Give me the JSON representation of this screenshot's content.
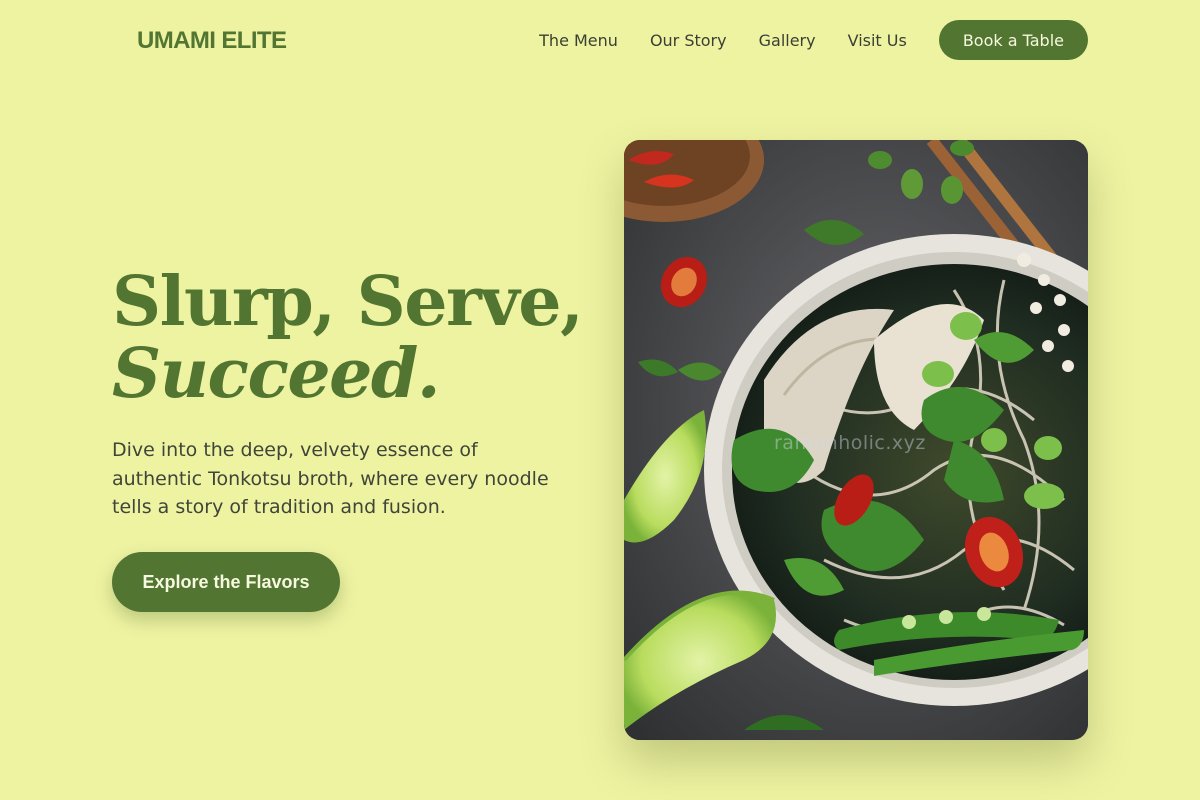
{
  "header": {
    "logo": "UMAMI ELITE",
    "nav": [
      "The Menu",
      "Our Story",
      "Gallery",
      "Visit Us"
    ],
    "cta": "Book a Table"
  },
  "hero": {
    "title_line1": "Slurp, Serve,",
    "title_line2": "Succeed.",
    "description": "Dive into the deep, velvety essence of authentic Tonkotsu broth, where every noodle tells a story of tradition and fusion.",
    "button": "Explore the Flavors",
    "image_watermark": "ramenholic.xyz"
  },
  "colors": {
    "background": "#eef3a2",
    "accent": "#527531",
    "text": "#3b3f34"
  }
}
